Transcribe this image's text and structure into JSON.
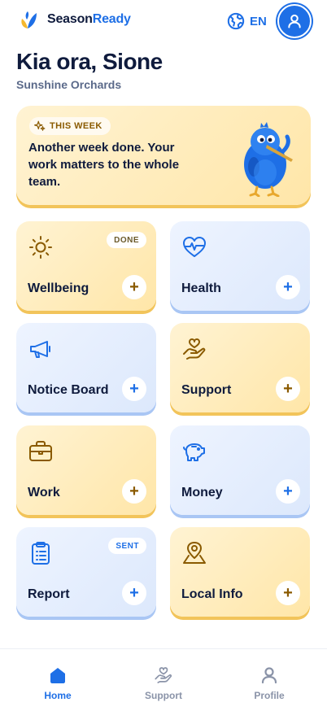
{
  "app": {
    "brand_part1": "Season",
    "brand_part2": "Ready",
    "language": "EN"
  },
  "header": {
    "greeting": "Kia ora, Sione",
    "subtitle": "Sunshine Orchards"
  },
  "week_card": {
    "badge": "THIS WEEK",
    "message": "Another week done. Your work matters to the whole team."
  },
  "tiles": [
    {
      "label": "Wellbeing",
      "icon": "sun-icon",
      "badge": "DONE",
      "theme": "yellow"
    },
    {
      "label": "Health",
      "icon": "heart-pulse-icon",
      "badge": "",
      "theme": "blue"
    },
    {
      "label": "Notice Board",
      "icon": "megaphone-icon",
      "badge": "",
      "theme": "blue"
    },
    {
      "label": "Support",
      "icon": "hand-heart-icon",
      "badge": "",
      "theme": "yellow"
    },
    {
      "label": "Work",
      "icon": "briefcase-icon",
      "badge": "",
      "theme": "yellow"
    },
    {
      "label": "Money",
      "icon": "piggy-bank-icon",
      "badge": "",
      "theme": "blue"
    },
    {
      "label": "Report",
      "icon": "clipboard-list-icon",
      "badge": "SENT",
      "theme": "blue"
    },
    {
      "label": "Local Info",
      "icon": "map-pin-icon",
      "badge": "",
      "theme": "yellow"
    }
  ],
  "tile_action": "+",
  "nav": [
    {
      "label": "Home",
      "icon": "home-icon",
      "active": true
    },
    {
      "label": "Support",
      "icon": "hand-heart-icon",
      "active": false
    },
    {
      "label": "Profile",
      "icon": "user-icon",
      "active": false
    }
  ],
  "colors": {
    "primary_blue": "#1e6fe6",
    "navy_text": "#0f1b3d",
    "yellow_card": "#ffe6a8",
    "blue_card": "#dce8fc",
    "gold_icon": "#8a5a00"
  }
}
